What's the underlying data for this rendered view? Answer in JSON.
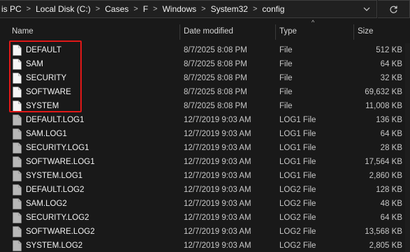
{
  "address": {
    "crumbs": [
      "is PC",
      "Local Disk (C:)",
      "Cases",
      "F",
      "Windows",
      "System32",
      "config"
    ],
    "separator": ">",
    "dropdown_icon": "chevron-down-icon",
    "refresh_icon": "refresh-icon"
  },
  "columns": {
    "name": "Name",
    "date": "Date modified",
    "type": "Type",
    "size": "Size",
    "sort_indicator": "^"
  },
  "files": [
    {
      "name": "DEFAULT",
      "date": "8/7/2025 8:08 PM",
      "type": "File",
      "size": "512 KB",
      "icon": "blank-file-icon"
    },
    {
      "name": "SAM",
      "date": "8/7/2025 8:08 PM",
      "type": "File",
      "size": "64 KB",
      "icon": "blank-file-icon"
    },
    {
      "name": "SECURITY",
      "date": "8/7/2025 8:08 PM",
      "type": "File",
      "size": "32 KB",
      "icon": "blank-file-icon"
    },
    {
      "name": "SOFTWARE",
      "date": "8/7/2025 8:08 PM",
      "type": "File",
      "size": "69,632 KB",
      "icon": "blank-file-icon"
    },
    {
      "name": "SYSTEM",
      "date": "8/7/2025 8:08 PM",
      "type": "File",
      "size": "11,008 KB",
      "icon": "blank-file-icon"
    },
    {
      "name": "DEFAULT.LOG1",
      "date": "12/7/2019 9:03 AM",
      "type": "LOG1 File",
      "size": "136 KB",
      "icon": "log-file-icon"
    },
    {
      "name": "SAM.LOG1",
      "date": "12/7/2019 9:03 AM",
      "type": "LOG1 File",
      "size": "64 KB",
      "icon": "log-file-icon"
    },
    {
      "name": "SECURITY.LOG1",
      "date": "12/7/2019 9:03 AM",
      "type": "LOG1 File",
      "size": "28 KB",
      "icon": "log-file-icon"
    },
    {
      "name": "SOFTWARE.LOG1",
      "date": "12/7/2019 9:03 AM",
      "type": "LOG1 File",
      "size": "17,564 KB",
      "icon": "log-file-icon"
    },
    {
      "name": "SYSTEM.LOG1",
      "date": "12/7/2019 9:03 AM",
      "type": "LOG1 File",
      "size": "2,860 KB",
      "icon": "log-file-icon"
    },
    {
      "name": "DEFAULT.LOG2",
      "date": "12/7/2019 9:03 AM",
      "type": "LOG2 File",
      "size": "128 KB",
      "icon": "log-file-icon"
    },
    {
      "name": "SAM.LOG2",
      "date": "12/7/2019 9:03 AM",
      "type": "LOG2 File",
      "size": "48 KB",
      "icon": "log-file-icon"
    },
    {
      "name": "SECURITY.LOG2",
      "date": "12/7/2019 9:03 AM",
      "type": "LOG2 File",
      "size": "64 KB",
      "icon": "log-file-icon"
    },
    {
      "name": "SOFTWARE.LOG2",
      "date": "12/7/2019 9:03 AM",
      "type": "LOG2 File",
      "size": "13,568 KB",
      "icon": "log-file-icon"
    },
    {
      "name": "SYSTEM.LOG2",
      "date": "12/7/2019 9:03 AM",
      "type": "LOG2 File",
      "size": "2,805 KB",
      "icon": "log-file-icon"
    }
  ],
  "colors": {
    "background": "#191919",
    "highlight_border": "#e01818",
    "blank_file": "#f5f5f5",
    "log_file": "#b8b8b8"
  }
}
